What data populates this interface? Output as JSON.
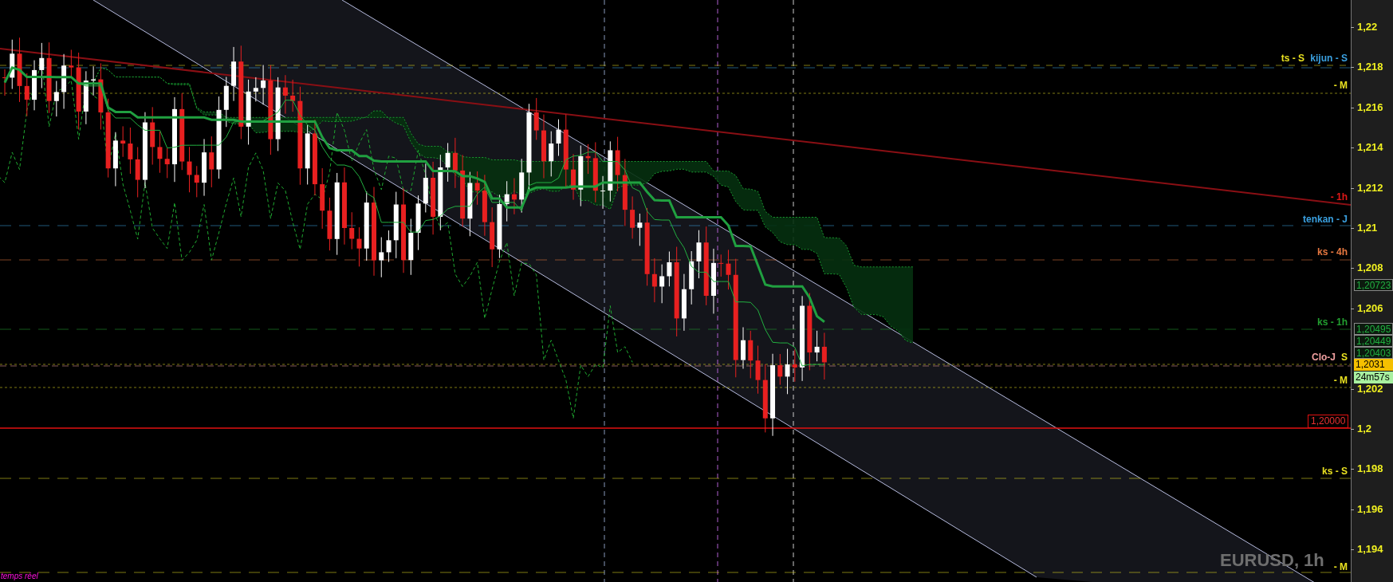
{
  "chart": {
    "symbol": "EURUSD, 1h",
    "feed_status": "temps réel",
    "price_axis": [
      "1,22",
      "1,218",
      "1,216",
      "1,214",
      "1,212",
      "1,21",
      "1,208",
      "1,206",
      "1,202",
      "1,2",
      "1,198",
      "1,196",
      "1,194"
    ],
    "level_labels": [
      {
        "label": "ts - S",
        "color": "#e8e020"
      },
      {
        "label": "kijun - S",
        "color": "#3aa0e0"
      },
      {
        "label": "- M",
        "color": "#e8e020"
      },
      {
        "label": "- 1h",
        "color": "#e01818"
      },
      {
        "label": "tenkan - J",
        "color": "#3aa0e0"
      },
      {
        "label": "ks - 4h",
        "color": "#e87840"
      },
      {
        "label": "ks - 1h",
        "color": "#22a030"
      },
      {
        "label": "Clo-J",
        "color": "#f0a0a0"
      },
      {
        "label": "S",
        "color": "#e8e020"
      },
      {
        "label": "- M",
        "color": "#e8e020"
      },
      {
        "label": "ks - S",
        "color": "#e8e020"
      },
      {
        "label": "- M",
        "color": "#e8e020"
      }
    ],
    "price_tags": [
      {
        "text": "1,20723",
        "kind": "indicator"
      },
      {
        "text": "1,20495",
        "kind": "indicator"
      },
      {
        "text": "1,20449",
        "kind": "indicator"
      },
      {
        "text": "1,20403",
        "kind": "indicator"
      },
      {
        "text": "1,2031",
        "kind": "last"
      },
      {
        "text": "24m57s",
        "kind": "timer"
      }
    ],
    "alert_tag": "1,20000"
  }
}
